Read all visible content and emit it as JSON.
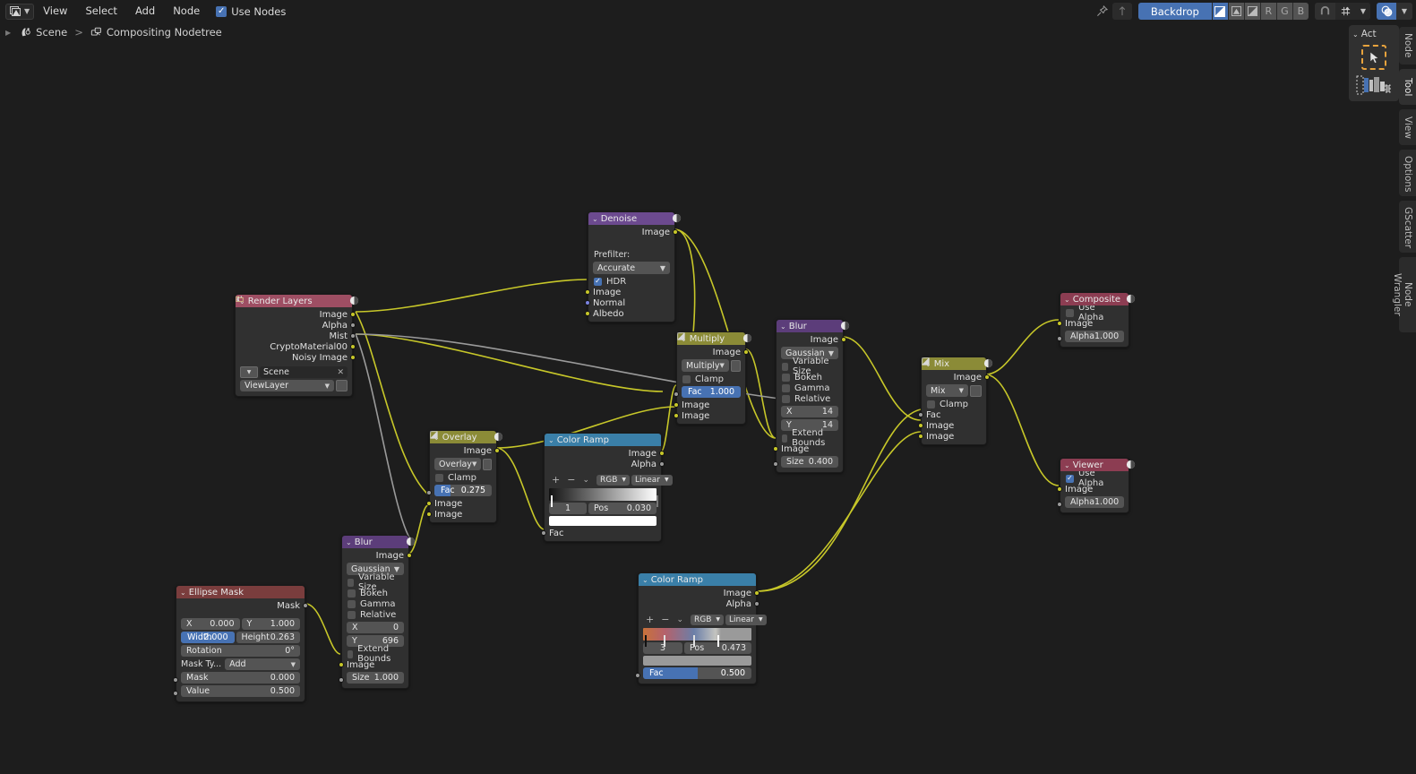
{
  "app": {
    "editor_type_icon": "image-editor-icon",
    "menus": [
      "View",
      "Select",
      "Add",
      "Node"
    ],
    "use_nodes": {
      "label": "Use Nodes",
      "checked": true
    }
  },
  "toolbar": {
    "pin_icon": "pin-icon",
    "parent_icon": "arrow-up-icon",
    "backdrop_label": "Backdrop",
    "channels": [
      {
        "name": "channel-color-alpha",
        "label": "",
        "active": true
      },
      {
        "name": "channel-color",
        "label": "",
        "active": false
      },
      {
        "name": "channel-alpha",
        "label": "",
        "active": false
      },
      {
        "name": "channel-r",
        "label": "R",
        "active": false
      },
      {
        "name": "channel-g",
        "label": "G",
        "active": false
      },
      {
        "name": "channel-b",
        "label": "B",
        "active": false
      }
    ],
    "snap_icon": "magnet-icon",
    "snap_target_icon": "snap-increment-icon",
    "overlays_icon": "overlays-icon"
  },
  "breadcrumb": {
    "scene_icon": "scene-icon",
    "scene": "Scene",
    "separator": ">",
    "nodetree_icon": "nodetree-icon",
    "nodetree": "Compositing Nodetree"
  },
  "sidebar": {
    "panel_title": "Act",
    "collapse_icon": "chevron-down-icon",
    "active_tool_icon": "cursor-select-box-icon",
    "tool_preview_icon": "tool-preview-icon",
    "tabs": [
      {
        "label": "Node",
        "active": false
      },
      {
        "label": "Tool",
        "active": true
      },
      {
        "label": "View",
        "active": false
      },
      {
        "label": "Options",
        "active": false
      },
      {
        "label": "GScatter",
        "active": false
      },
      {
        "label": "Node Wrangler",
        "active": false
      }
    ]
  },
  "colors": {
    "canvas_bg": "#1d1d1d",
    "node_body": "#303030",
    "header_input": "#9e4e63",
    "header_color": "#6c4a8f",
    "header_converter": "#8b8b37",
    "header_output": "#8c3d52",
    "header_matte": "#3a7fa8",
    "header_distort": "#5c3d7a",
    "header_mask": "#7a3d3d",
    "accent_blue": "#4772b3",
    "wire_yellow": "#c7c729",
    "wire_gray": "#9a9a9a",
    "select_orange": "#e8a33d"
  },
  "nodes": {
    "render_layers": {
      "title": "Render Layers",
      "outputs": [
        "Image",
        "Alpha",
        "Mist",
        "CryptoMaterial00",
        "Noisy Image"
      ],
      "scene_field": {
        "value": "Scene",
        "clear_icon": "x-icon",
        "scene_icon": "scene-browse-icon"
      },
      "viewlayer_field": {
        "value": "ViewLayer",
        "browse_icon": "folder-icon"
      }
    },
    "denoise": {
      "title": "Denoise",
      "outputs": [
        "Image"
      ],
      "prefilter_label": "Prefilter:",
      "prefilter_value": "Accurate",
      "hdr": {
        "label": "HDR",
        "checked": true
      },
      "inputs": [
        "Image",
        "Normal",
        "Albedo"
      ]
    },
    "multiply": {
      "title": "Multiply",
      "outputs": [
        "Image"
      ],
      "blend_mode": "Multiply",
      "clamp": {
        "label": "Clamp",
        "checked": false
      },
      "fac": {
        "label": "Fac",
        "value": "1.000",
        "pct": 100
      },
      "inputs": [
        "Image",
        "Image"
      ]
    },
    "blur_top": {
      "title": "Blur",
      "outputs": [
        "Image"
      ],
      "filter_type": "Gaussian",
      "checks": [
        {
          "label": "Variable Size",
          "checked": false
        },
        {
          "label": "Bokeh",
          "checked": false
        },
        {
          "label": "Gamma",
          "checked": false
        },
        {
          "label": "Relative",
          "checked": false
        }
      ],
      "x": {
        "label": "X",
        "value": "14"
      },
      "y": {
        "label": "Y",
        "value": "14"
      },
      "extend_bounds": {
        "label": "Extend Bounds",
        "checked": false
      },
      "image_input": "Image",
      "size": {
        "label": "Size",
        "value": "0.400"
      }
    },
    "mix": {
      "title": "Mix",
      "outputs": [
        "Image"
      ],
      "blend_mode": "Mix",
      "clamp": {
        "label": "Clamp",
        "checked": false
      },
      "inputs": [
        "Fac",
        "Image",
        "Image"
      ]
    },
    "composite": {
      "title": "Composite",
      "use_alpha": {
        "label": "Use Alpha",
        "checked": false
      },
      "image_input": "Image",
      "alpha": {
        "label": "Alpha",
        "value": "1.000"
      }
    },
    "viewer": {
      "title": "Viewer",
      "use_alpha": {
        "label": "Use Alpha",
        "checked": true
      },
      "image_input": "Image",
      "alpha": {
        "label": "Alpha",
        "value": "1.000"
      }
    },
    "overlay": {
      "title": "Overlay",
      "outputs": [
        "Image"
      ],
      "blend_mode": "Overlay",
      "clamp": {
        "label": "Clamp",
        "checked": false
      },
      "fac": {
        "label": "Fac",
        "value": "0.275",
        "pct": 27.5
      },
      "inputs": [
        "Image",
        "Image"
      ]
    },
    "color_ramp_1": {
      "title": "Color Ramp",
      "outputs": [
        "Image",
        "Alpha"
      ],
      "tools": {
        "add": "+",
        "remove": "−",
        "menu_icon": "chevron-down-icon"
      },
      "color_mode": "RGB",
      "interpolation": "Linear",
      "index": "1",
      "pos_label": "Pos",
      "pos_value": "0.030",
      "swatch": "#ffffff",
      "input": "Fac",
      "stops": [
        {
          "pos": 0.03,
          "color": "#000000"
        },
        {
          "pos": 1.0,
          "color": "#ffffff"
        }
      ]
    },
    "color_ramp_2": {
      "title": "Color Ramp",
      "outputs": [
        "Image",
        "Alpha"
      ],
      "tools": {
        "add": "+",
        "remove": "−",
        "menu_icon": "chevron-down-icon"
      },
      "color_mode": "RGB",
      "interpolation": "Linear",
      "index": "3",
      "pos_label": "Pos",
      "pos_value": "0.473",
      "swatch": "#9a9a9a",
      "fac": {
        "label": "Fac",
        "value": "0.500",
        "pct": 50
      },
      "stops": [
        {
          "pos": 0.02,
          "color": "#c8723a"
        },
        {
          "pos": 0.2,
          "color": "#b5616b"
        },
        {
          "pos": 0.47,
          "color": "#6b7fa8"
        },
        {
          "pos": 0.7,
          "color": "#c4c4c0"
        }
      ]
    },
    "blur_bottom": {
      "title": "Blur",
      "outputs": [
        "Image"
      ],
      "filter_type": "Gaussian",
      "checks": [
        {
          "label": "Variable Size",
          "checked": false
        },
        {
          "label": "Bokeh",
          "checked": false
        },
        {
          "label": "Gamma",
          "checked": false
        },
        {
          "label": "Relative",
          "checked": false
        }
      ],
      "x": {
        "label": "X",
        "value": "0"
      },
      "y": {
        "label": "Y",
        "value": "696"
      },
      "extend_bounds": {
        "label": "Extend Bounds",
        "checked": false
      },
      "image_input": "Image",
      "size": {
        "label": "Size",
        "value": "1.000"
      }
    },
    "ellipse_mask": {
      "title": "Ellipse Mask",
      "outputs": [
        "Mask"
      ],
      "x": {
        "label": "X",
        "value": "0.000"
      },
      "y": {
        "label": "Y",
        "value": "1.000"
      },
      "width": {
        "label": "Width",
        "value": "2.000",
        "pct": 68
      },
      "height": {
        "label": "Height",
        "value": "0.263"
      },
      "rotation": {
        "label": "Rotation",
        "value": "0°"
      },
      "mask_type": {
        "label": "Mask Ty...",
        "value": "Add"
      },
      "mask": {
        "label": "Mask",
        "value": "0.000"
      },
      "value": {
        "label": "Value",
        "value": "0.500"
      }
    }
  }
}
